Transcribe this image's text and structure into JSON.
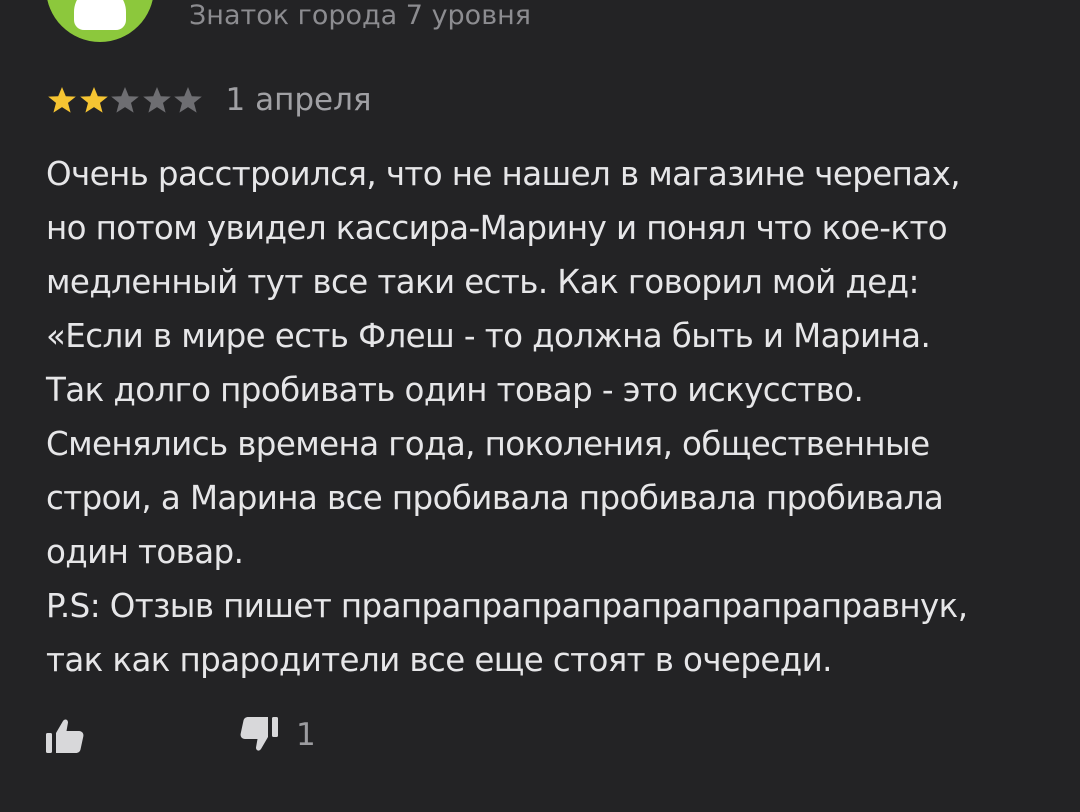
{
  "author": {
    "level_text": "Знаток города 7 уровня",
    "avatar_color": "#8cc83c"
  },
  "rating": {
    "value": 2,
    "max": 5,
    "filled_color": "#f5c432",
    "empty_color": "#6e6e72"
  },
  "review": {
    "date": "1 апреля",
    "lines": [
      "Очень расстроился, что не нашел в магазине черепах,",
      "но потом увидел кассира-Марину и понял что кое-кто",
      "медленный тут все таки есть. Как говорил мой дед:",
      "«Если в мире есть Флеш - то должна быть и Марина.",
      "Так долго пробивать один товар - это искусство.",
      "Сменялись времена года, поколения, общественные",
      "строи, а Марина все пробивала пробивала пробивала",
      "один товар.",
      "P.S: Отзыв пишет прапрапрапрапрапрапрапраправнук,",
      "так как прародители все еще стоят в очереди."
    ]
  },
  "reactions": {
    "like_icon": "thumbs-up-icon",
    "dislike_icon": "thumbs-down-icon",
    "dislike_count": "1"
  }
}
